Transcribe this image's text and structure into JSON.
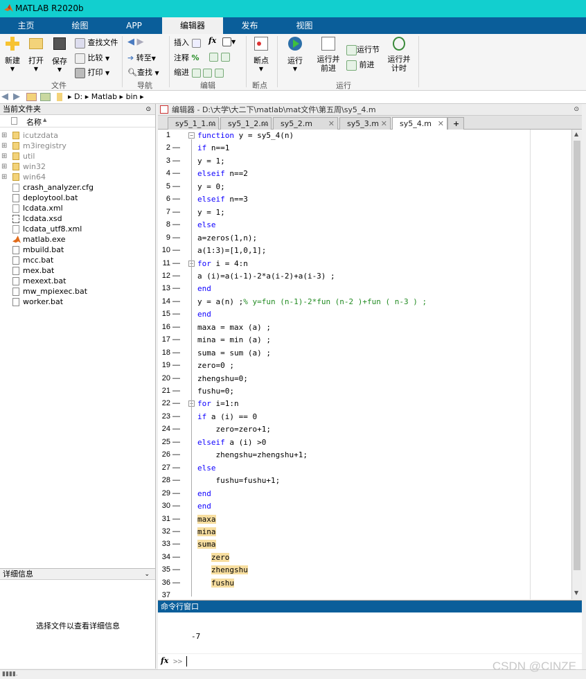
{
  "window": {
    "title": "MATLAB R2020b"
  },
  "top_tabs": [
    "主页",
    "绘图",
    "APP",
    "编辑器",
    "发布",
    "视图"
  ],
  "ribbon": {
    "file": {
      "new": "新建",
      "open": "打开",
      "save": "保存",
      "find_files": "查找文件",
      "compare": "比较",
      "print": "打印",
      "section": "文件"
    },
    "navigate": {
      "goto": "转至",
      "find": "查找",
      "section": "导航"
    },
    "edit": {
      "insert": "插入",
      "fx": "fx",
      "comment": "注释",
      "percent": "%",
      "indent": "缩进",
      "section": "编辑"
    },
    "breakpoints": {
      "breakpoints": "断点",
      "section": "断点"
    },
    "run": {
      "run": "运行",
      "run_advance": "运行并\n前进",
      "run_section": "运行节",
      "advance": "前进",
      "run_time": "运行并\n计时",
      "section": "运行"
    }
  },
  "address": {
    "path": [
      "D:",
      "Matlab",
      "bin"
    ]
  },
  "current_folder": {
    "title": "当前文件夹",
    "column": "名称",
    "items": [
      {
        "name": "icutzdata",
        "type": "folder"
      },
      {
        "name": "m3iregistry",
        "type": "folder"
      },
      {
        "name": "util",
        "type": "folder"
      },
      {
        "name": "win32",
        "type": "folder"
      },
      {
        "name": "win64",
        "type": "folder"
      },
      {
        "name": "crash_analyzer.cfg",
        "type": "file"
      },
      {
        "name": "deploytool.bat",
        "type": "bat"
      },
      {
        "name": "lcdata.xml",
        "type": "file"
      },
      {
        "name": "lcdata.xsd",
        "type": "xsd"
      },
      {
        "name": "lcdata_utf8.xml",
        "type": "file"
      },
      {
        "name": "matlab.exe",
        "type": "exe"
      },
      {
        "name": "mbuild.bat",
        "type": "bat"
      },
      {
        "name": "mcc.bat",
        "type": "bat"
      },
      {
        "name": "mex.bat",
        "type": "bat"
      },
      {
        "name": "mexext.bat",
        "type": "bat"
      },
      {
        "name": "mw_mpiexec.bat",
        "type": "bat"
      },
      {
        "name": "worker.bat",
        "type": "bat"
      }
    ]
  },
  "details": {
    "title": "详细信息",
    "message": "选择文件以查看详细信息"
  },
  "editor": {
    "header": "编辑器 - D:\\大学\\大二下\\matlab\\mat文件\\第五周\\sy5_4.m",
    "tabs": [
      "sy5_1_1.m",
      "sy5_1_2.m",
      "sy5_2.m",
      "sy5_3.m",
      "sy5_4.m"
    ],
    "active_tab": "sy5_4.m",
    "lines": [
      "function y = sy5_4(n)",
      "if n==1",
      "y = 1;",
      "elseif n==2",
      "y = 0;",
      "elseif n==3",
      "y = 1;",
      "else",
      "a=zeros(1,n);",
      "a(1:3)=[1,0,1];",
      "for i = 4:n",
      "a (i)=a(i-1)-2*a(i-2)+a(i-3) ;",
      "end",
      "y = a(n) ;% y=fun (n-1)-2*fun (n-2 )+fun ( n-3 ) ;",
      "end",
      "maxa = max (a) ;",
      "mina = min (a) ;",
      "suma = sum (a) ;",
      "zero=0 ;",
      "zhengshu=0;",
      "fushu=0;",
      "for i=1:n",
      "if a (i) == 0",
      "    zero=zero+1;",
      "elseif a (i) >0",
      "    zhengshu=zhengshu+1;",
      "else",
      "    fushu=fushu+1;",
      "end",
      "end",
      "maxa",
      "mina",
      "suma",
      "   zero",
      "   zhengshu",
      "   fushu",
      ""
    ]
  },
  "command_window": {
    "title": "命令行窗口",
    "output": "-7",
    "prompt": ">>"
  },
  "watermark": "CSDN @CINZE"
}
